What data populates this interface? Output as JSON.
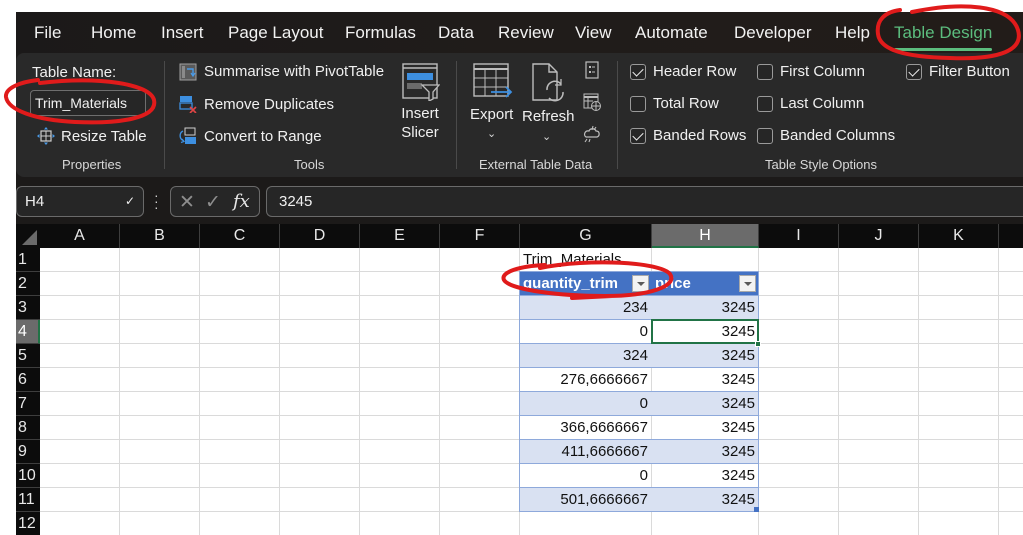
{
  "tabs": [
    {
      "label": "File",
      "active": false
    },
    {
      "label": "Home",
      "active": false
    },
    {
      "label": "Insert",
      "active": false
    },
    {
      "label": "Page Layout",
      "active": false
    },
    {
      "label": "Formulas",
      "active": false
    },
    {
      "label": "Data",
      "active": false
    },
    {
      "label": "Review",
      "active": false
    },
    {
      "label": "View",
      "active": false
    },
    {
      "label": "Automate",
      "active": false
    },
    {
      "label": "Developer",
      "active": false
    },
    {
      "label": "Help",
      "active": false
    },
    {
      "label": "Table Design",
      "active": true
    }
  ],
  "ribbon": {
    "properties": {
      "table_name_label": "Table Name:",
      "table_name_value": "Trim_Materials",
      "resize_table": "Resize Table",
      "group_label": "Properties"
    },
    "tools": {
      "pivot": "Summarise with PivotTable",
      "remove_duplicates": "Remove Duplicates",
      "convert_to_range": "Convert to Range",
      "insert_slicer_line1": "Insert",
      "insert_slicer_line2": "Slicer",
      "group_label": "Tools"
    },
    "external": {
      "export": "Export",
      "refresh": "Refresh",
      "group_label": "External Table Data"
    },
    "style_options": {
      "group_label": "Table Style Options",
      "options": [
        {
          "label": "Header Row",
          "checked": true
        },
        {
          "label": "Total Row",
          "checked": false
        },
        {
          "label": "Banded Rows",
          "checked": true
        },
        {
          "label": "First Column",
          "checked": false
        },
        {
          "label": "Last Column",
          "checked": false
        },
        {
          "label": "Banded Columns",
          "checked": false
        },
        {
          "label": "Filter Button",
          "checked": true
        }
      ]
    }
  },
  "formula_bar": {
    "name_box": "H4",
    "cancel_glyph": "✕",
    "enter_glyph": "✓",
    "fx_glyph": "fx",
    "formula": "3245"
  },
  "sheet": {
    "columns": [
      "A",
      "B",
      "C",
      "D",
      "E",
      "F",
      "G",
      "H",
      "I",
      "J",
      "K"
    ],
    "rows": [
      "1",
      "2",
      "3",
      "4",
      "5",
      "6",
      "7",
      "8",
      "9",
      "10",
      "11",
      "12"
    ],
    "selected_column": "H",
    "selected_row": "4",
    "table_title": "Trim_Materials",
    "table": {
      "headers": [
        "quantity_trim",
        "price"
      ],
      "rows": [
        [
          "234",
          "3245"
        ],
        [
          "0",
          "3245"
        ],
        [
          "324",
          "3245"
        ],
        [
          "276,6666667",
          "3245"
        ],
        [
          "0",
          "3245"
        ],
        [
          "366,6666667",
          "3245"
        ],
        [
          "411,6666667",
          "3245"
        ],
        [
          "0",
          "3245"
        ],
        [
          "501,6666667",
          "3245"
        ]
      ]
    }
  },
  "colors": {
    "accent_green": "#5cbd7e",
    "table_header": "#4472c4",
    "table_band": "#d9e1f2",
    "selection": "#217346",
    "annotation": "#e01b1b"
  }
}
